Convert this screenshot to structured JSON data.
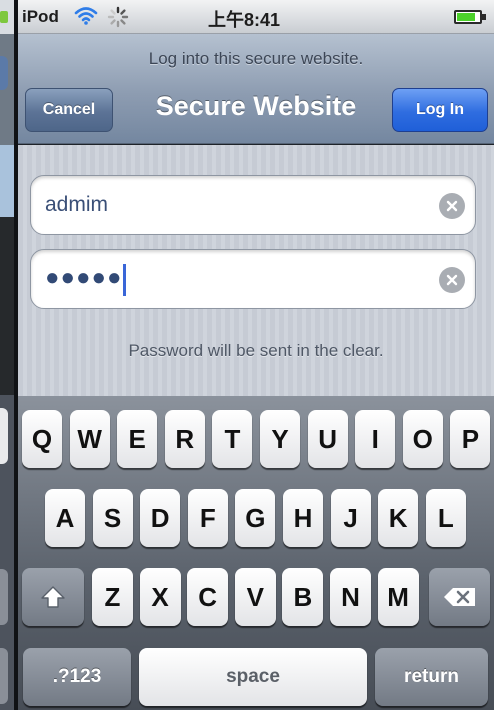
{
  "status_bar": {
    "carrier": "iPod",
    "time": "上午8:41",
    "battery_level": 0.75,
    "icons": [
      "wifi-icon",
      "activity-spinner-icon",
      "battery-icon"
    ]
  },
  "header": {
    "prompt": "Log into this secure website.",
    "title": "Secure Website",
    "cancel_label": "Cancel",
    "login_label": "Log In"
  },
  "form": {
    "username_value": "admim",
    "password_mask": "●●●●●",
    "notice": "Password will be sent in the clear."
  },
  "keyboard": {
    "row1": [
      "Q",
      "W",
      "E",
      "R",
      "T",
      "Y",
      "U",
      "I",
      "O",
      "P"
    ],
    "row2": [
      "A",
      "S",
      "D",
      "F",
      "G",
      "H",
      "J",
      "K",
      "L"
    ],
    "row3": [
      "Z",
      "X",
      "C",
      "V",
      "B",
      "N",
      "M"
    ],
    "numbers_label": ".?123",
    "space_label": "space",
    "return_label": "return"
  },
  "colors": {
    "accent_blue": "#2f6de0",
    "nav_bar": "#8d9cb1",
    "keyboard_bg": "#5a616b"
  }
}
